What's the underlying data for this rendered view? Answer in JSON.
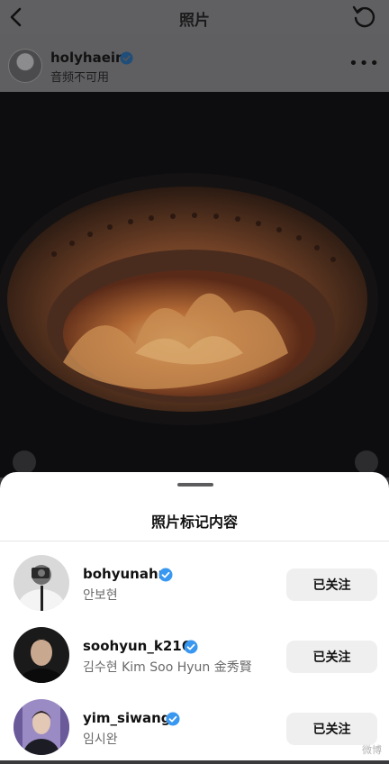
{
  "header": {
    "title": "照片"
  },
  "post_user": {
    "username": "holyhaein",
    "audio_status": "音频不可用",
    "more_label": "•••"
  },
  "tags_sheet": {
    "title": "照片标记内容",
    "users": [
      {
        "username": "bohyunahn",
        "full_name": "안보현",
        "follow_label": "已关注"
      },
      {
        "username": "soohyun_k216",
        "full_name": "김수현 Kim Soo Hyun 金秀賢",
        "follow_label": "已关注"
      },
      {
        "username": "yim_siwang",
        "full_name": "임시완",
        "follow_label": "已关注"
      }
    ]
  },
  "watermark": "微博",
  "colors": {
    "verified_blue": "#3897f0",
    "follow_button_bg": "#efefef"
  },
  "icons": [
    "back-arrow-icon",
    "refresh-icon",
    "verified-badge-icon",
    "more-icon",
    "person-icon",
    "mute-icon"
  ]
}
